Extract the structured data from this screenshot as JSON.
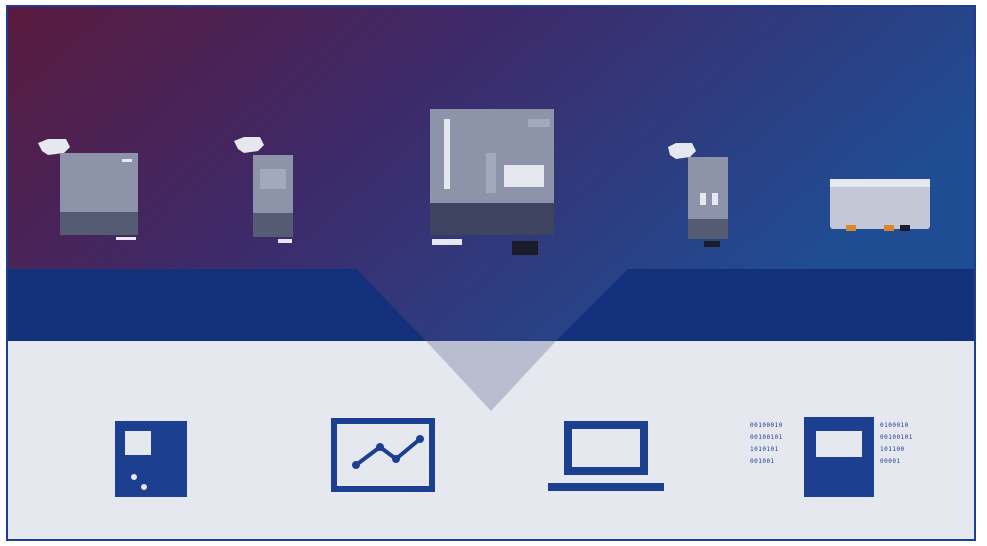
{
  "colors": {
    "band_dark": "#13317a",
    "panel_light": "#e6e8f0",
    "icon_blue": "#1d3f8f",
    "device_gray": "#8d93a8"
  },
  "devices": [
    {
      "name": "device-1",
      "icon": "power-supply-module-with-cable"
    },
    {
      "name": "device-2",
      "icon": "narrow-module-with-cable"
    },
    {
      "name": "device-3",
      "icon": "central-controller-module"
    },
    {
      "name": "device-4",
      "icon": "narrow-module-with-cable"
    },
    {
      "name": "device-5",
      "icon": "box-enclosure"
    }
  ],
  "bottom_icons": [
    "handheld-panel-icon",
    "monitor-chart-icon",
    "laptop-icon",
    "binary-data-module-icon"
  ],
  "binary_text": {
    "left": [
      "00100010",
      "00100101",
      "1010101",
      "001001"
    ],
    "right": [
      "0100010",
      "00100101",
      "101100",
      "00001"
    ]
  }
}
